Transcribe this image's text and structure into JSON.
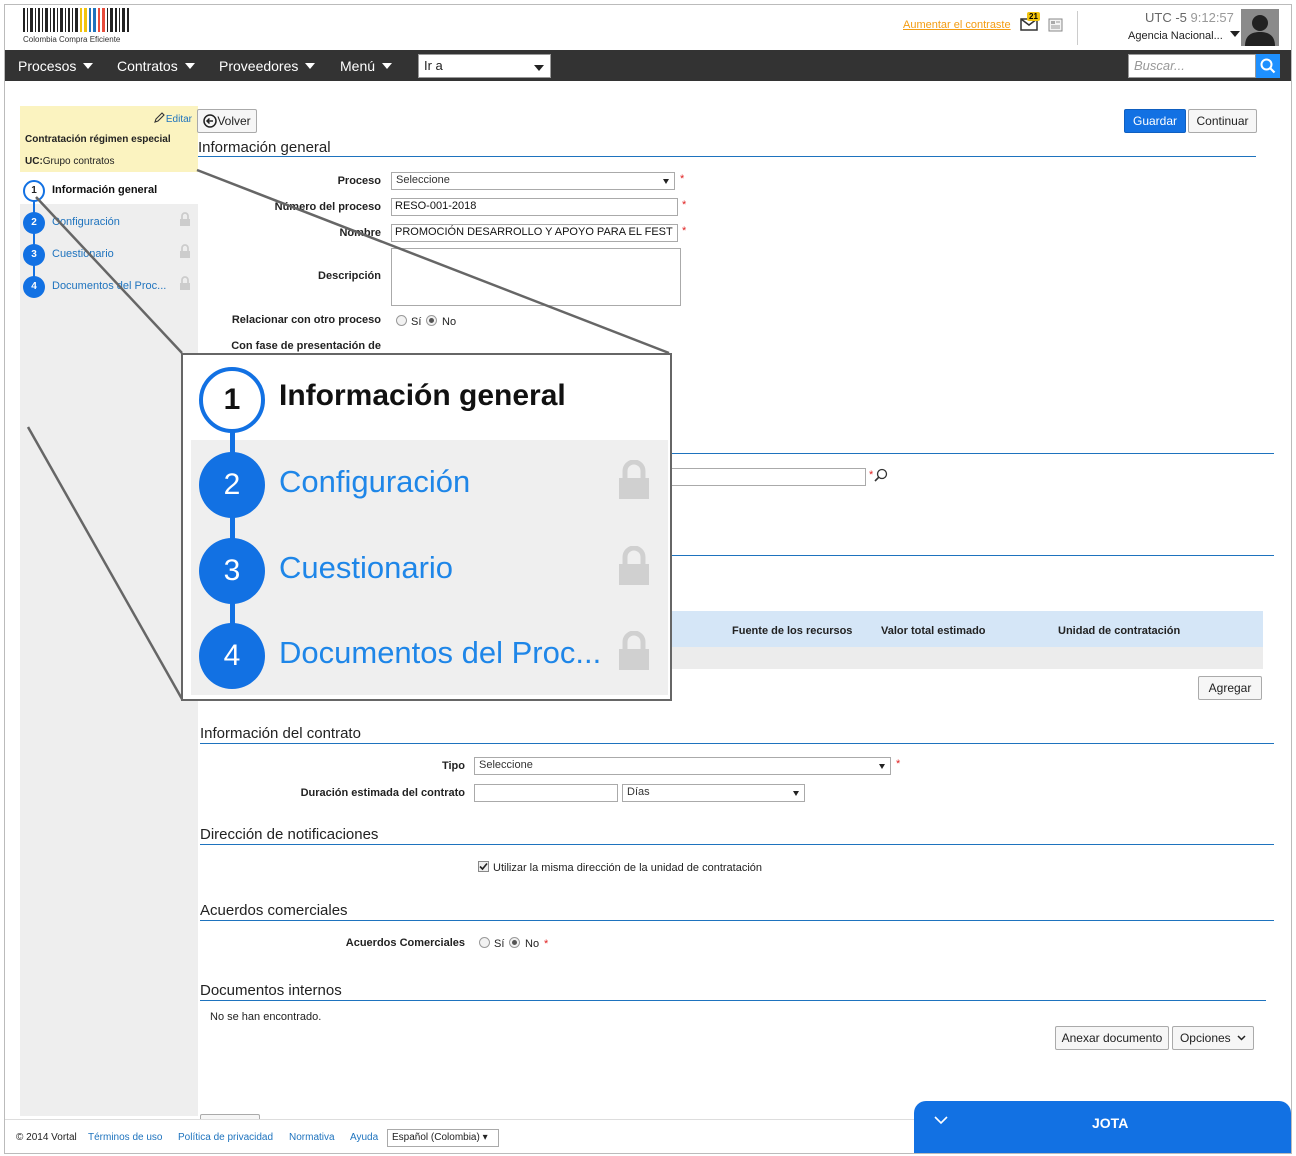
{
  "header": {
    "logo_text": "Colombia Compra Eficiente",
    "contrast_link": "Aumentar el contraste",
    "mail_count": "21",
    "timezone_label": "UTC -5",
    "time": "9:12:57",
    "agency": "Agencia Nacional..."
  },
  "nav": {
    "items": [
      "Procesos",
      "Contratos",
      "Proveedores",
      "Menú"
    ],
    "goto_label": "Ir a",
    "search_placeholder": "Buscar..."
  },
  "sidebar": {
    "edit_label": "Editar",
    "title": "Contratación régimen especial",
    "uc_prefix": "UC:",
    "uc_value": "Grupo contratos",
    "steps": [
      {
        "num": "1",
        "label": "Información general",
        "active": true
      },
      {
        "num": "2",
        "label": "Configuración",
        "locked": true
      },
      {
        "num": "3",
        "label": "Cuestionario",
        "locked": true
      },
      {
        "num": "4",
        "label": "Documentos del Proc...",
        "locked": true
      }
    ]
  },
  "zoom": {
    "steps": [
      {
        "num": "1",
        "label": "Información general"
      },
      {
        "num": "2",
        "label": "Configuración"
      },
      {
        "num": "3",
        "label": "Cuestionario"
      },
      {
        "num": "4",
        "label": "Documentos del Proc..."
      }
    ]
  },
  "toolbar": {
    "back_label": "Volver",
    "save_label": "Guardar",
    "continue_label": "Continuar"
  },
  "general": {
    "section_title": "Información general",
    "proceso_label": "Proceso",
    "proceso_value": "Seleccione",
    "numero_label": "Número del proceso",
    "numero_value": "RESO-001-2018",
    "nombre_label": "Nombre",
    "nombre_value": "PROMOCIÓN DESARROLLO Y APOYO PARA EL FEST",
    "descripcion_label": "Descripción",
    "relacionar_label": "Relacionar con otro proceso",
    "fase_label": "Con fase de presentación de",
    "si_label": "Sí",
    "no_label": "No"
  },
  "table": {
    "headers": [
      "Fuente de los recursos",
      "Valor total estimado",
      "Unidad de contratación"
    ],
    "add_label": "Agregar"
  },
  "contract": {
    "section_title": "Información del contrato",
    "tipo_label": "Tipo",
    "tipo_value": "Seleccione",
    "duracion_label": "Duración estimada del contrato",
    "duracion_unit": "Días"
  },
  "notifications": {
    "section_title": "Dirección de notificaciones",
    "checkbox_label": "Utilizar la misma dirección de la unidad de contratación"
  },
  "agreements": {
    "section_title": "Acuerdos comerciales",
    "label": "Acuerdos Comerciales",
    "si_label": "Sí",
    "no_label": "No"
  },
  "documents": {
    "section_title": "Documentos internos",
    "empty_text": "No se han encontrado.",
    "attach_label": "Anexar documento",
    "options_label": "Opciones"
  },
  "footer": {
    "copyright": "© 2014 Vortal",
    "links": [
      "Términos de uso",
      "Política de privacidad",
      "Normativa",
      "Ayuda"
    ],
    "language": "Español (Colombia)"
  },
  "chat": {
    "title": "JOTA"
  },
  "colors": {
    "accent": "#1271e3",
    "nav_bg": "#333333",
    "sidebar_highlight": "#fbf3c0"
  }
}
